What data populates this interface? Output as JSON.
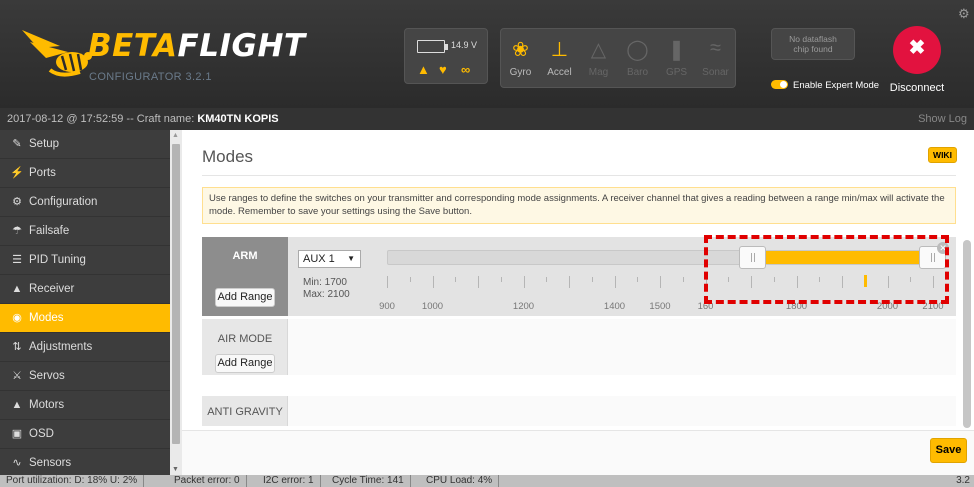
{
  "header": {
    "logo_main": "BETA",
    "logo_accent": "FLIGHT",
    "logo_sub": "CONFIGURATOR 3.2.1",
    "battery_voltage": "14.9 V",
    "sensors": [
      {
        "label": "Gyro",
        "icon": "gyro-icon",
        "active": true
      },
      {
        "label": "Accel",
        "icon": "accel-icon",
        "active": true
      },
      {
        "label": "Mag",
        "icon": "mag-icon",
        "active": false
      },
      {
        "label": "Baro",
        "icon": "baro-icon",
        "active": false
      },
      {
        "label": "GPS",
        "icon": "gps-icon",
        "active": false
      },
      {
        "label": "Sonar",
        "icon": "sonar-icon",
        "active": false
      }
    ],
    "dataflash_line1": "No dataflash",
    "dataflash_line2": "chip found",
    "expert_mode_label": "Enable Expert Mode",
    "disconnect_label": "Disconnect"
  },
  "infobar": {
    "prefix": "2017-08-12 @ 17:52:59 -- Craft name: ",
    "craft_name": "KM40TN KOPIS",
    "show_log": "Show Log"
  },
  "sidebar": {
    "items": [
      {
        "label": "Setup",
        "icon": "wrench-icon",
        "active": false
      },
      {
        "label": "Ports",
        "icon": "plug-icon",
        "active": false
      },
      {
        "label": "Configuration",
        "icon": "gear-icon",
        "active": false
      },
      {
        "label": "Failsafe",
        "icon": "parachute-icon",
        "active": false
      },
      {
        "label": "PID Tuning",
        "icon": "sliders-icon",
        "active": false
      },
      {
        "label": "Receiver",
        "icon": "antenna-icon",
        "active": false
      },
      {
        "label": "Modes",
        "icon": "toggle-icon",
        "active": true
      },
      {
        "label": "Adjustments",
        "icon": "adjustments-icon",
        "active": false
      },
      {
        "label": "Servos",
        "icon": "servo-icon",
        "active": false
      },
      {
        "label": "Motors",
        "icon": "motor-icon",
        "active": false
      },
      {
        "label": "OSD",
        "icon": "osd-icon",
        "active": false
      },
      {
        "label": "Sensors",
        "icon": "sensors-icon",
        "active": false
      }
    ]
  },
  "main": {
    "title": "Modes",
    "wiki_label": "WIKI",
    "note": "Use ranges to define the switches on your transmitter and corresponding mode assignments. A receiver channel that gives a reading between a range min/max will activate the mode. Remember to save your settings using the Save button.",
    "add_range_label": "Add Range",
    "modes": [
      {
        "name": "ARM",
        "channel": "AUX 1",
        "min_label": "Min: 1700",
        "max_label": "Max: 2100",
        "range_min": 1700,
        "range_max": 2100,
        "live_value": 1950
      },
      {
        "name": "AIR MODE"
      },
      {
        "name": "ANTI GRAVITY"
      }
    ],
    "scale_min": 900,
    "scale_max": 2100,
    "scale_labels": [
      {
        "value": 900,
        "text": "900"
      },
      {
        "value": 1000,
        "text": "1000"
      },
      {
        "value": 1200,
        "text": "1200"
      },
      {
        "value": 1400,
        "text": "1400"
      },
      {
        "value": 1500,
        "text": "1500"
      },
      {
        "value": 1600,
        "text": "160"
      },
      {
        "value": 1800,
        "text": "1800"
      },
      {
        "value": 2000,
        "text": "2000"
      },
      {
        "value": 2100,
        "text": "2100"
      }
    ],
    "save_label": "Save"
  },
  "statusbar": {
    "port_utilization": "Port utilization: D: 18% U: 2%",
    "packet_error": "Packet error: 0",
    "i2c_error": "I2C error: 1",
    "cycle_time": "Cycle Time: 141",
    "cpu_load": "CPU Load: 4%",
    "version": "3.2"
  },
  "colors": {
    "accent": "#ffbb00",
    "header_bg": "#2e2e2e",
    "sidebar_bg": "#3d3d3d",
    "disconnect": "#e2123f",
    "highlight": "#e00000"
  }
}
